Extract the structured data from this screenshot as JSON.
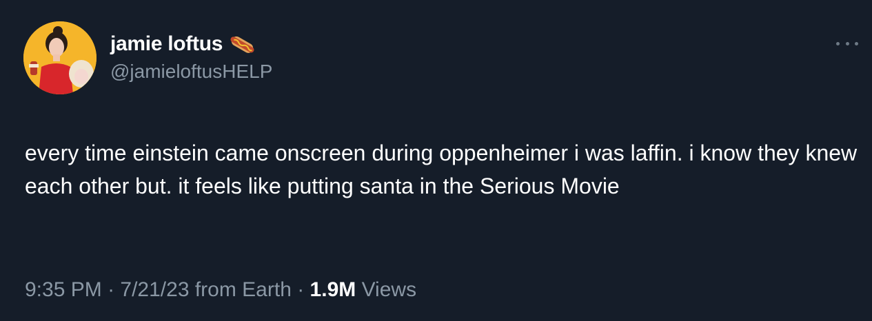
{
  "author": {
    "display_name": "jamie loftus",
    "emoji_icon": "hotdog-icon",
    "handle": "@jamieloftusHELP",
    "avatar_bg": "#f5b52a"
  },
  "tweet": {
    "text": "every time einstein came onscreen during oppenheimer i was laffin. i know they knew each other but. it feels like putting santa in the Serious Movie"
  },
  "meta": {
    "time": "9:35 PM",
    "sep1": " · ",
    "date": "7/21/23",
    "source": " from Earth",
    "sep2": " · ",
    "views_count": "1.9M",
    "views_label": " Views"
  },
  "colors": {
    "background": "#151d29",
    "secondary_text": "#8b98a5",
    "primary_text": "#ffffff"
  }
}
